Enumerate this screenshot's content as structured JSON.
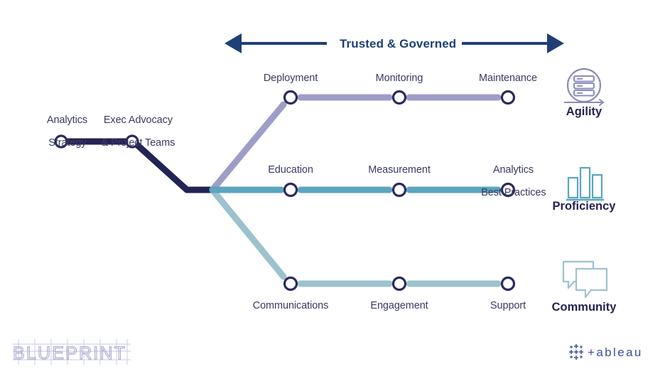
{
  "header": {
    "title": "Trusted & Governed",
    "arrow_color": "#1f4075"
  },
  "colors": {
    "navy_dark": "#232355",
    "node_ring": "#2b2b5f",
    "agility_line": "#9d9dc8",
    "proficiency_line": "#5ba5bf",
    "community_line": "#9cc2cd",
    "label_text": "#3a3a63",
    "title_text": "#232355",
    "logo_blueprint": "#a8a8d0",
    "logo_tableau": "#3b4fa3"
  },
  "stem": {
    "nodes": [
      {
        "label_line1": "Analytics",
        "label_line2": "Strategy",
        "name": "analytics-strategy"
      },
      {
        "label_line1": "Exec Advocacy",
        "label_line2": "& Project Teams",
        "name": "exec-advocacy-project-teams"
      }
    ]
  },
  "branches": [
    {
      "id": "agility",
      "pillar": "Agility",
      "icon": "server-stack-circle-arrow-icon",
      "line_color": "#9d9dc8",
      "labels_position": "above",
      "nodes": [
        {
          "label": "Deployment"
        },
        {
          "label": "Monitoring"
        },
        {
          "label": "Maintenance"
        }
      ]
    },
    {
      "id": "proficiency",
      "pillar": "Proficiency",
      "icon": "bar-chart-icon",
      "line_color": "#5ba5bf",
      "labels_position": "above",
      "nodes": [
        {
          "label": "Education"
        },
        {
          "label": "Measurement"
        },
        {
          "label_line1": "Analytics",
          "label_line2": "Best Practices",
          "label": "Analytics Best Practices"
        }
      ]
    },
    {
      "id": "community",
      "pillar": "Community",
      "icon": "speech-bubbles-icon",
      "line_color": "#9cc2cd",
      "labels_position": "below",
      "nodes": [
        {
          "label": "Communications"
        },
        {
          "label": "Engagement"
        },
        {
          "label": "Support"
        }
      ]
    }
  ],
  "logos": {
    "blueprint": "BLUEPRINT",
    "tableau": "+ableau"
  }
}
